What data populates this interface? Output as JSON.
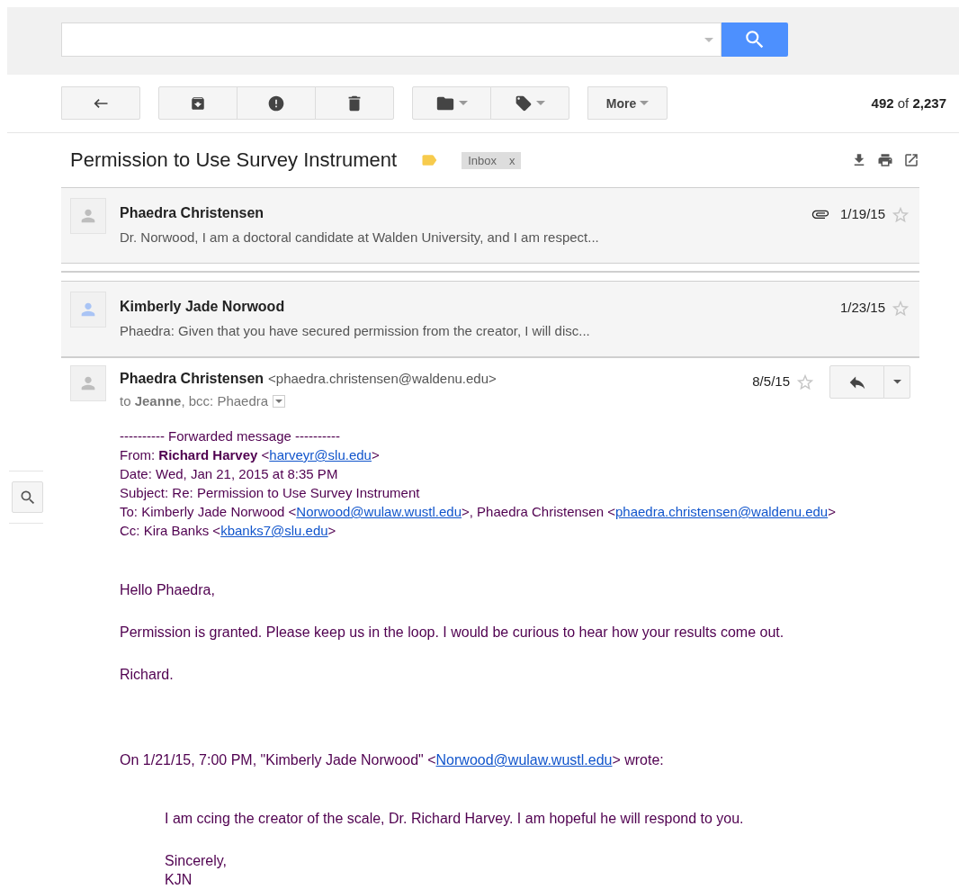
{
  "toolbar": {
    "more": "More",
    "count": "**492** of **2,237**"
  },
  "subject": "Permission to Use Survey Instrument",
  "labels": [
    {
      "text": "Inbox",
      "remove": "x"
    }
  ],
  "thread": [
    {
      "kind": "collapsed",
      "sender": "Phaedra Christensen",
      "snippet": "Dr. Norwood, I am a doctoral candidate at Walden University, and I am respect...",
      "date": "1/19/15",
      "attachment": true,
      "starred": false,
      "color": "#bdbdbd"
    },
    {
      "kind": "gap"
    },
    {
      "kind": "collapsed",
      "sender": "Kimberly Jade Norwood",
      "snippet": "Phaedra: Given that you have secured permission from the creator, I will disc...",
      "date": "1/23/15",
      "attachment": false,
      "starred": false,
      "color": "#a9c4f5"
    },
    {
      "kind": "expanded",
      "sender": "Phaedra Christensen",
      "email": "<phaedra.christensen@waldenu.edu>",
      "to": "to **Jeanne**, bcc: Phaedra",
      "date": "8/5/15",
      "starred": false,
      "color": "#bdbdbd",
      "body": [
        {
          "kind": "header",
          "lines": [
            [
              {
                "text": "---------- Forwarded message ----------",
                "link": false
              }
            ],
            [
              {
                "text": "From: **Richard Harvey** <",
                "link": false
              },
              {
                "text": "harveyr@slu.edu",
                "link": true
              },
              {
                "text": ">",
                "link": false
              }
            ],
            [
              {
                "text": "Date: Wed, Jan 21, 2015 at 8:35 PM",
                "link": false
              }
            ],
            [
              {
                "text": "Subject: Re: Permission to Use Survey Instrument",
                "link": false
              }
            ],
            [
              {
                "text": "To: Kimberly Jade Norwood <",
                "link": false
              },
              {
                "text": "Norwood@wulaw.wustl.edu",
                "link": true
              },
              {
                "text": ">, Phaedra Christensen <",
                "link": false
              },
              {
                "text": "phaedra.christensen@waldenu.edu",
                "link": true
              },
              {
                "text": ">",
                "link": false
              }
            ],
            [
              {
                "text": "Cc: Kira Banks <",
                "link": false
              },
              {
                "text": "kbanks7@slu.edu",
                "link": true
              },
              {
                "text": ">",
                "link": false
              }
            ]
          ]
        },
        {
          "kind": "plain",
          "lines": [
            [
              {
                "text": "Hello Phaedra,",
                "link": false
              }
            ]
          ]
        },
        {
          "kind": "plain",
          "lines": [
            [
              {
                "text": "Permission is granted. Please keep us in the loop. I would be curious to hear how your results come out.",
                "link": false
              }
            ]
          ]
        },
        {
          "kind": "plain",
          "lines": [
            [
              {
                "text": "Richard.",
                "link": false
              }
            ]
          ]
        },
        {
          "kind": "attribution",
          "lines": [
            [
              {
                "text": "On 1/21/15, 7:00 PM, \"Kimberly Jade Norwood\" <",
                "link": false
              },
              {
                "text": "Norwood@wulaw.wustl.edu",
                "link": true
              },
              {
                "text": "> wrote:",
                "link": false
              }
            ]
          ]
        },
        {
          "kind": "quote",
          "lines": [
            [
              {
                "text": "I am ccing the creator of the scale, Dr. Richard Harvey.  I am hopeful he will respond to you.",
                "link": false
              }
            ]
          ]
        },
        {
          "kind": "quote",
          "lines": [
            [
              {
                "text": "Sincerely,",
                "link": false
              }
            ],
            [
              {
                "text": "KJN",
                "link": false
              }
            ]
          ]
        }
      ]
    }
  ]
}
